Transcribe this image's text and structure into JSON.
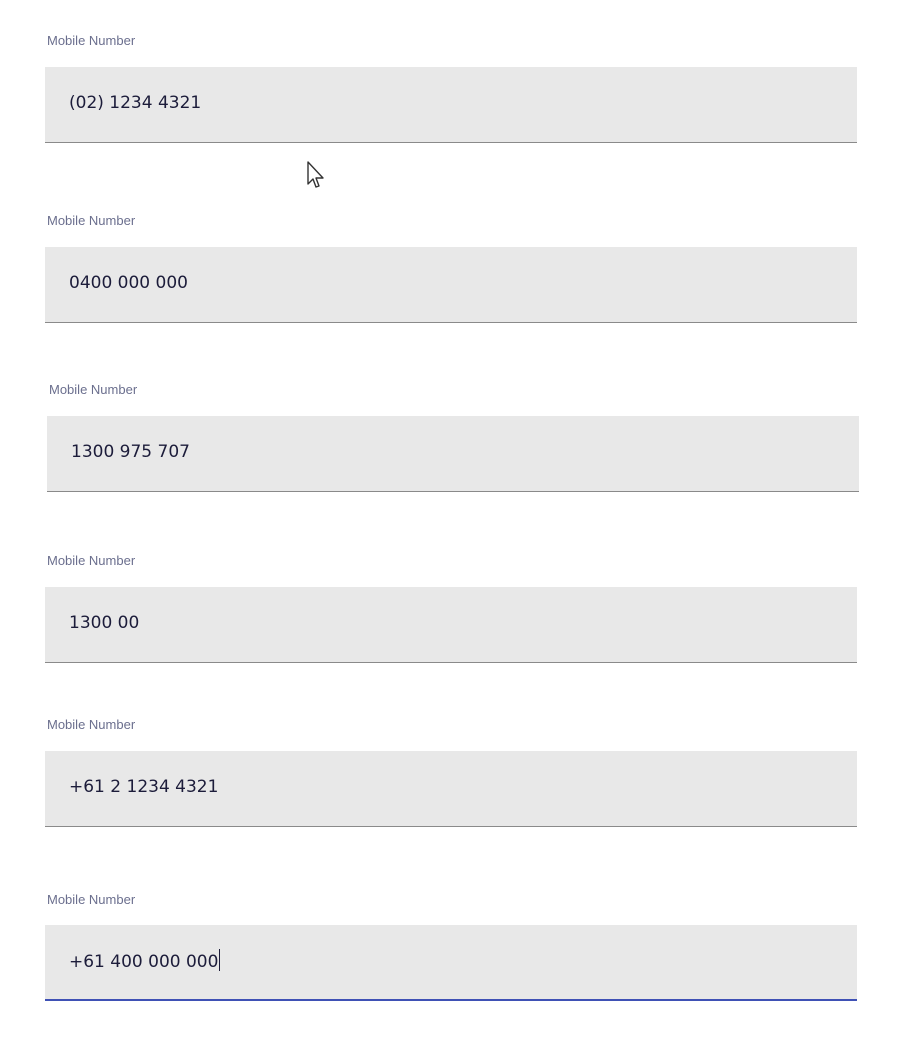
{
  "fields": [
    {
      "label": "Mobile Number",
      "value": "(02) 1234 4321",
      "focused": false
    },
    {
      "label": "Mobile Number",
      "value": "0400 000 000",
      "focused": false
    },
    {
      "label": "Mobile Number",
      "value": "1300 975 707",
      "focused": false
    },
    {
      "label": "Mobile Number",
      "value": "1300 00",
      "focused": false
    },
    {
      "label": "Mobile Number",
      "value": "+61 2 1234 4321",
      "focused": false
    },
    {
      "label": "Mobile Number",
      "value": "+61 400 000 000",
      "focused": true
    }
  ],
  "colors": {
    "label": "#6b6f8e",
    "field_background": "#e8e8e8",
    "field_underline": "#8a8a8a",
    "focus_underline": "#3f51b5",
    "value_text": "#1c1c3a"
  },
  "pointer": {
    "icon": "mouse-pointer-icon"
  }
}
